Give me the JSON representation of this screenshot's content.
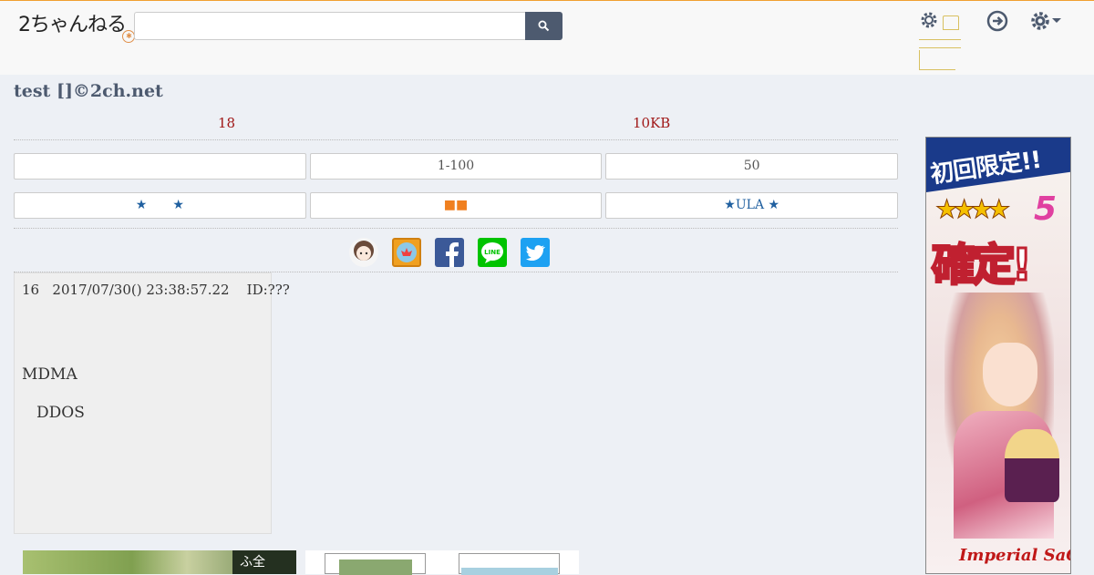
{
  "header": {
    "logo_text": "2ちゃんねる",
    "search_placeholder": ""
  },
  "thread": {
    "title": "test []©2ch.net",
    "reply_count": "18",
    "size": "10KB"
  },
  "nav_row1": [
    "",
    "1-100",
    "50"
  ],
  "nav_row2": [
    "★　　★",
    "■■",
    "★ULA  ★"
  ],
  "social": [
    "avatar-app-icon",
    "bookmark-app-icon",
    "facebook-icon",
    "line-icon",
    "twitter-icon"
  ],
  "post": {
    "number": "16",
    "date": "2017/07/30() 23:38:57.22",
    "id": "ID:???",
    "line1": "MDMA",
    "line2": "DDOS"
  },
  "ad": {
    "headline": "初回限定!!",
    "rating": "★★★★",
    "rating_num": "5",
    "main": "確定!",
    "brand": "Imperial SaGa"
  },
  "thumbs": {
    "tag_text": "ふ全"
  },
  "colors": {
    "accent": "#4d5a6f",
    "stats_red": "#a01818",
    "link_blue": "#2060a0",
    "orange": "#f08020"
  }
}
